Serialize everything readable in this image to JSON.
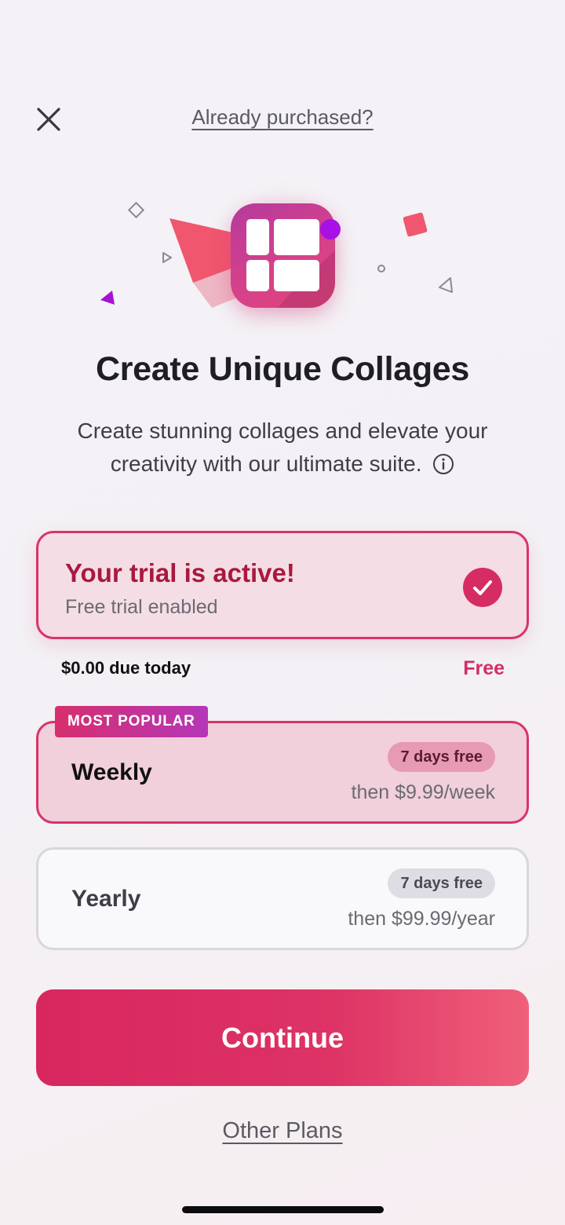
{
  "header": {
    "close_icon": "close-icon",
    "already_purchased": "Already purchased?"
  },
  "hero": {
    "app_icon": "collage-app-icon",
    "decorations": [
      "diamond-outline",
      "paper-plane",
      "play-triangle",
      "purple-triangle",
      "pink-square",
      "small-circle",
      "triangle-outline"
    ]
  },
  "main": {
    "title": "Create Unique Collages",
    "subtitle": "Create stunning collages and elevate your creativity with our ultimate suite."
  },
  "trial": {
    "title": "Your trial is active!",
    "subtitle": "Free trial enabled",
    "status": "checked",
    "due_today": "$0.00 due today",
    "price_label": "Free"
  },
  "plans": [
    {
      "badge": "MOST POPULAR",
      "name": "Weekly",
      "trial": "7 days free",
      "price": "then $9.99/week",
      "selected": true
    },
    {
      "name": "Yearly",
      "trial": "7 days free",
      "price": "then $99.99/year",
      "selected": false
    }
  ],
  "actions": {
    "continue": "Continue",
    "other_plans": "Other Plans"
  },
  "colors": {
    "accent": "#d62c64",
    "accent_dark": "#a8193f",
    "badge_purple": "#b536b9",
    "selected_bg": "#f1cfdb"
  }
}
